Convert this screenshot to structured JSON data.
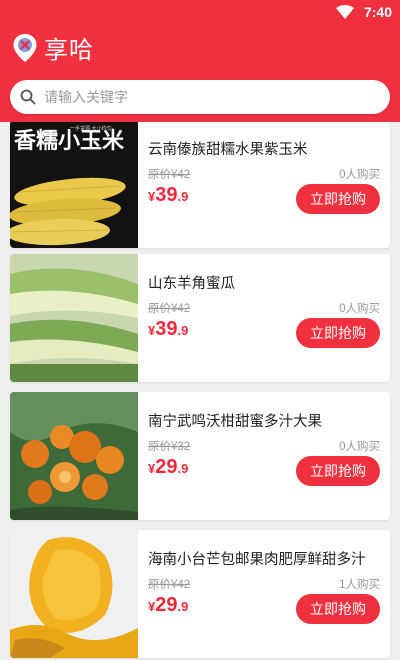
{
  "status": {
    "time": "7:40"
  },
  "app": {
    "title": "享哈"
  },
  "search": {
    "placeholder": "请输入关键字"
  },
  "products": [
    {
      "title": "云南傣族甜糯水果紫玉米",
      "original_price": "原价¥42",
      "sold": "0人购买",
      "price_symbol": "¥",
      "price_int": "39",
      "price_dec": ".9",
      "button": "立即抢购",
      "image_text": "香糯小玉米",
      "image_subtext": "一手货源·大小均匀"
    },
    {
      "title": "山东羊角蜜瓜",
      "original_price": "原价¥42",
      "sold": "0人购买",
      "price_symbol": "¥",
      "price_int": "39",
      "price_dec": ".9",
      "button": "立即抢购"
    },
    {
      "title": "南宁武鸣沃柑甜蜜多汁大果",
      "original_price": "原价¥32",
      "sold": "0人购买",
      "price_symbol": "¥",
      "price_int": "29",
      "price_dec": ".9",
      "button": "立即抢购"
    },
    {
      "title": "海南小台芒包邮果肉肥厚鲜甜多汁",
      "original_price": "原价¥42",
      "sold": "1人购买",
      "price_symbol": "¥",
      "price_int": "29",
      "price_dec": ".9",
      "button": "立即抢购"
    }
  ],
  "colors": {
    "brand": "#f0303f",
    "price": "#ee2b3d"
  }
}
